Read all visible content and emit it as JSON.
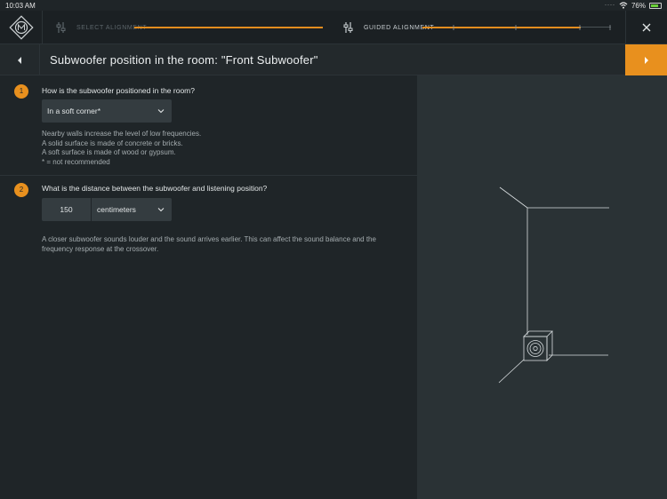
{
  "status": {
    "time": "10:03 AM",
    "battery": "76%"
  },
  "nav": {
    "steps": [
      {
        "label": "Select Alignment",
        "icon": "sliders-icon"
      },
      {
        "label": "Guided alignment",
        "icon": "sliders-icon"
      }
    ]
  },
  "header": {
    "title": "Subwoofer position in the room:  \"Front Subwoofer\""
  },
  "questions": [
    {
      "number": "1",
      "text": "How is the subwoofer positioned in the room?",
      "select_value": "In a soft corner*",
      "help": [
        "Nearby walls increase the level of low frequencies.",
        "A solid surface is made of concrete or bricks.",
        "A soft surface is made of wood or gypsum.",
        "* = not recommended"
      ]
    },
    {
      "number": "2",
      "text": "What is the distance between the subwoofer and listening position?",
      "distance_value": "150",
      "unit_value": "centimeters",
      "help": [
        "A closer subwoofer sounds louder and the sound arrives earlier. This can affect the sound balance and the",
        "frequency response at the crossover."
      ]
    }
  ],
  "colors": {
    "accent": "#e8901e",
    "background": "#1f2528",
    "panel": "#2a3235"
  }
}
